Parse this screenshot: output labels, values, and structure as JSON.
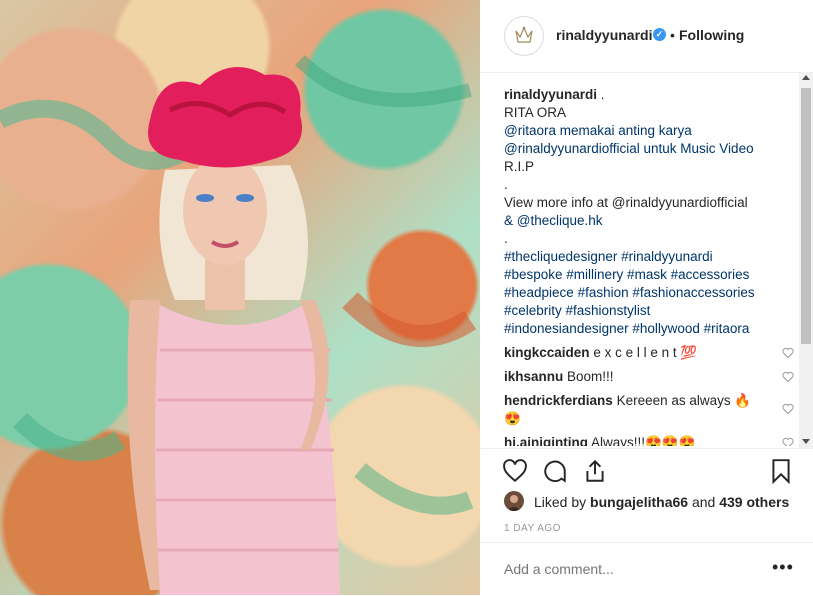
{
  "post": {
    "image_alt": "Rita Ora in pink fringe dress with red headpiece"
  },
  "header": {
    "username": "rinaldyyunardi",
    "verified_icon": "verified-badge-icon",
    "separator": "•",
    "follow_status": "Following"
  },
  "caption": {
    "username": "rinaldyyunardi",
    "lines": [
      ".",
      "RITA ORA",
      "@ritaora memakai anting karya",
      "@rinaldyyunardiofficial untuk Music Video",
      "R.I.P",
      ".",
      "View more info at @rinaldyyunardiofficial",
      "& @theclique.hk",
      ".",
      "#thecliquedesigner #rinaldyyunardi",
      "#bespoke #millinery #mask #accessories",
      "#headpiece #fashion #fashionaccessories",
      "#celebrity #fashionstylist",
      "#indonesiandesigner #hollywood #ritaora"
    ]
  },
  "comments": [
    {
      "user": "kingkccaiden",
      "text": "e x c e l l e n t 💯"
    },
    {
      "user": "ikhsannu",
      "text": "Boom!!!"
    },
    {
      "user": "hendrickferdians",
      "text": "Kereeen as always 🔥",
      "text2": "😍"
    },
    {
      "user": "hi.ainiginting",
      "text": "Always!!!😍😍😍"
    }
  ],
  "likes": {
    "prefix": "Liked by",
    "user": "bungajelitha66",
    "and": "and",
    "others": "439 others"
  },
  "timestamp": "1 DAY AGO",
  "add_comment": {
    "placeholder": "Add a comment..."
  },
  "more_label": "•••"
}
